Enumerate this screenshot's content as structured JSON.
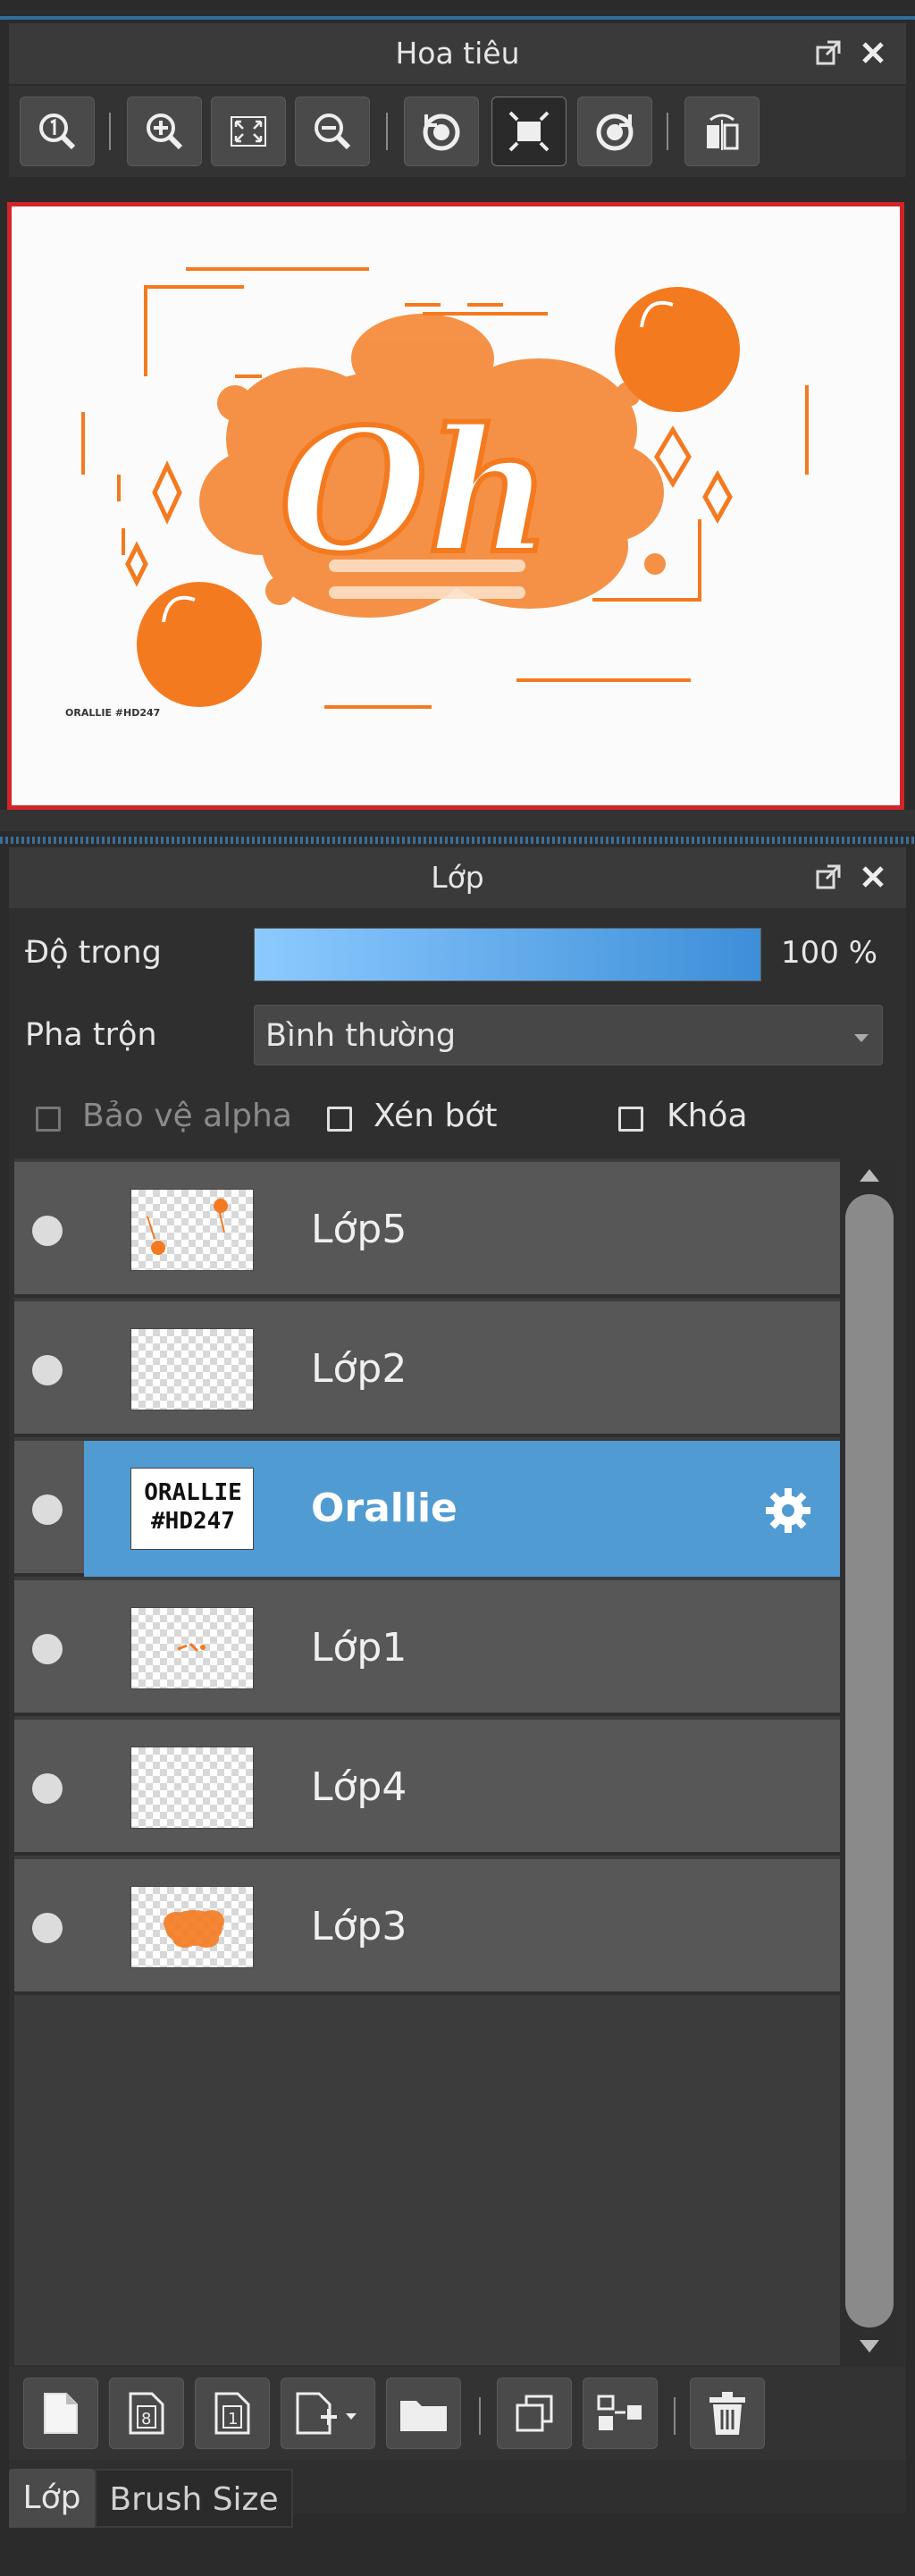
{
  "navigator": {
    "title": "Hoa tiêu",
    "toolbar_icons": [
      "zoom-actual-icon",
      "zoom-in-icon",
      "fit-screen-icon",
      "zoom-out-icon",
      "rotate-left-icon",
      "fit-frame-icon",
      "rotate-right-icon",
      "flip-horizontal-icon"
    ],
    "preview": {
      "main_text": "Oh",
      "signature": "ORALLIE #HD247",
      "accent": "#f47a1f"
    }
  },
  "layers_panel": {
    "title": "Lớp",
    "opacity_label": "Độ trong",
    "opacity_value": "100 %",
    "opacity_level": 1.0,
    "blend_label": "Pha trộn",
    "blend_value": "Bình thường",
    "protect_alpha": "Bảo vệ alpha",
    "clip": "Xén bớt",
    "lock": "Khóa",
    "layers": [
      {
        "name": "Lớp5",
        "selected": false,
        "thumb": "dots"
      },
      {
        "name": "Lớp2",
        "selected": false,
        "thumb": "empty"
      },
      {
        "name": "Orallie",
        "selected": true,
        "thumb": "text",
        "thumb_text_1": "ORALLIE",
        "thumb_text_2": "#HD247"
      },
      {
        "name": "Lớp1",
        "selected": false,
        "thumb": "small"
      },
      {
        "name": "Lớp4",
        "selected": false,
        "thumb": "empty"
      },
      {
        "name": "Lớp3",
        "selected": false,
        "thumb": "blob"
      }
    ],
    "bottom_icons": [
      "new-layer-icon",
      "new-8bit-layer-icon",
      "new-1bit-layer-icon",
      "add-layer-menu-icon",
      "folder-icon",
      "duplicate-layer-icon",
      "merge-down-icon",
      "delete-icon"
    ]
  },
  "tabs": {
    "active": "Lớp",
    "other": "Brush Size"
  },
  "colors": {
    "selection": "#519bd3",
    "accent_orange": "#f47a1f",
    "frame_red": "#d2252a"
  }
}
